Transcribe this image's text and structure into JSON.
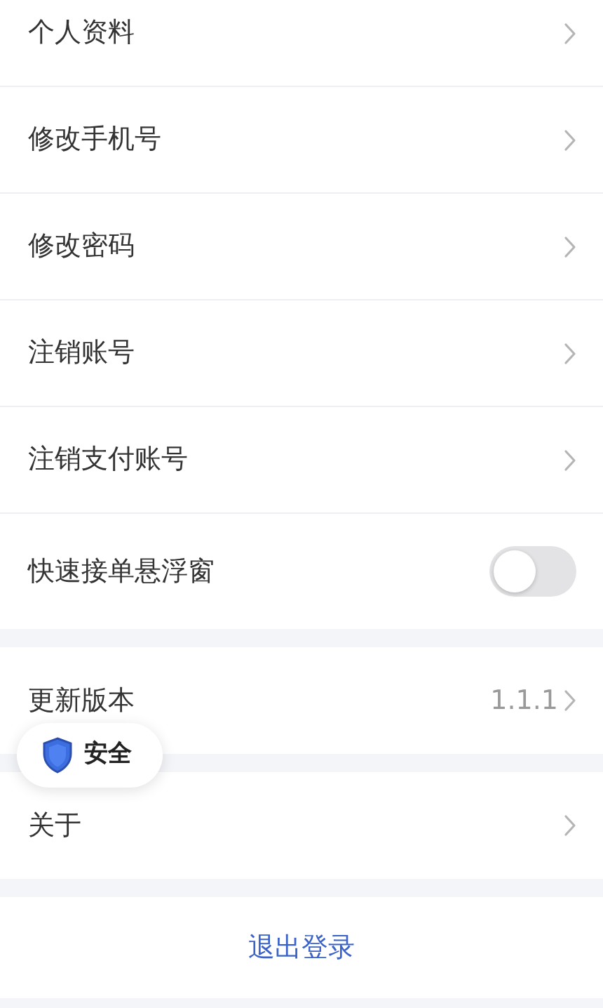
{
  "groups": [
    {
      "items": [
        {
          "kind": "link",
          "label": "个人资料"
        },
        {
          "kind": "link",
          "label": "修改手机号"
        },
        {
          "kind": "link",
          "label": "修改密码"
        },
        {
          "kind": "link",
          "label": "注销账号"
        },
        {
          "kind": "link",
          "label": "注销支付账号"
        },
        {
          "kind": "toggle",
          "label": "快速接单悬浮窗",
          "on": false
        }
      ]
    },
    {
      "items": [
        {
          "kind": "value",
          "label": "更新版本",
          "value": "1.1.1"
        }
      ]
    },
    {
      "items": [
        {
          "kind": "link",
          "label": "关于"
        }
      ]
    }
  ],
  "logout": {
    "label": "退出登录"
  },
  "security_badge": {
    "label": "安全"
  }
}
